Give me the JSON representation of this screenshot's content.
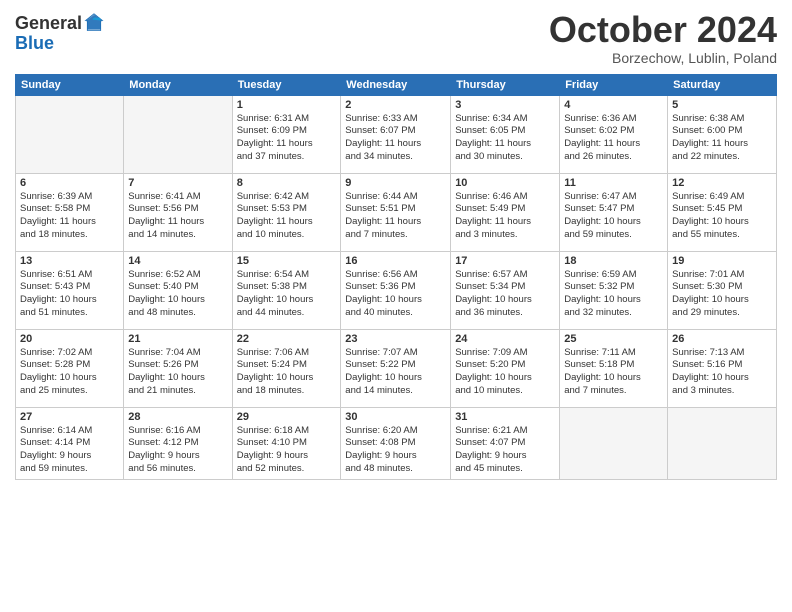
{
  "header": {
    "logo_general": "General",
    "logo_blue": "Blue",
    "month": "October 2024",
    "location": "Borzechow, Lublin, Poland"
  },
  "weekdays": [
    "Sunday",
    "Monday",
    "Tuesday",
    "Wednesday",
    "Thursday",
    "Friday",
    "Saturday"
  ],
  "weeks": [
    [
      {
        "day": "",
        "detail": ""
      },
      {
        "day": "",
        "detail": ""
      },
      {
        "day": "1",
        "detail": "Sunrise: 6:31 AM\nSunset: 6:09 PM\nDaylight: 11 hours\nand 37 minutes."
      },
      {
        "day": "2",
        "detail": "Sunrise: 6:33 AM\nSunset: 6:07 PM\nDaylight: 11 hours\nand 34 minutes."
      },
      {
        "day": "3",
        "detail": "Sunrise: 6:34 AM\nSunset: 6:05 PM\nDaylight: 11 hours\nand 30 minutes."
      },
      {
        "day": "4",
        "detail": "Sunrise: 6:36 AM\nSunset: 6:02 PM\nDaylight: 11 hours\nand 26 minutes."
      },
      {
        "day": "5",
        "detail": "Sunrise: 6:38 AM\nSunset: 6:00 PM\nDaylight: 11 hours\nand 22 minutes."
      }
    ],
    [
      {
        "day": "6",
        "detail": "Sunrise: 6:39 AM\nSunset: 5:58 PM\nDaylight: 11 hours\nand 18 minutes."
      },
      {
        "day": "7",
        "detail": "Sunrise: 6:41 AM\nSunset: 5:56 PM\nDaylight: 11 hours\nand 14 minutes."
      },
      {
        "day": "8",
        "detail": "Sunrise: 6:42 AM\nSunset: 5:53 PM\nDaylight: 11 hours\nand 10 minutes."
      },
      {
        "day": "9",
        "detail": "Sunrise: 6:44 AM\nSunset: 5:51 PM\nDaylight: 11 hours\nand 7 minutes."
      },
      {
        "day": "10",
        "detail": "Sunrise: 6:46 AM\nSunset: 5:49 PM\nDaylight: 11 hours\nand 3 minutes."
      },
      {
        "day": "11",
        "detail": "Sunrise: 6:47 AM\nSunset: 5:47 PM\nDaylight: 10 hours\nand 59 minutes."
      },
      {
        "day": "12",
        "detail": "Sunrise: 6:49 AM\nSunset: 5:45 PM\nDaylight: 10 hours\nand 55 minutes."
      }
    ],
    [
      {
        "day": "13",
        "detail": "Sunrise: 6:51 AM\nSunset: 5:43 PM\nDaylight: 10 hours\nand 51 minutes."
      },
      {
        "day": "14",
        "detail": "Sunrise: 6:52 AM\nSunset: 5:40 PM\nDaylight: 10 hours\nand 48 minutes."
      },
      {
        "day": "15",
        "detail": "Sunrise: 6:54 AM\nSunset: 5:38 PM\nDaylight: 10 hours\nand 44 minutes."
      },
      {
        "day": "16",
        "detail": "Sunrise: 6:56 AM\nSunset: 5:36 PM\nDaylight: 10 hours\nand 40 minutes."
      },
      {
        "day": "17",
        "detail": "Sunrise: 6:57 AM\nSunset: 5:34 PM\nDaylight: 10 hours\nand 36 minutes."
      },
      {
        "day": "18",
        "detail": "Sunrise: 6:59 AM\nSunset: 5:32 PM\nDaylight: 10 hours\nand 32 minutes."
      },
      {
        "day": "19",
        "detail": "Sunrise: 7:01 AM\nSunset: 5:30 PM\nDaylight: 10 hours\nand 29 minutes."
      }
    ],
    [
      {
        "day": "20",
        "detail": "Sunrise: 7:02 AM\nSunset: 5:28 PM\nDaylight: 10 hours\nand 25 minutes."
      },
      {
        "day": "21",
        "detail": "Sunrise: 7:04 AM\nSunset: 5:26 PM\nDaylight: 10 hours\nand 21 minutes."
      },
      {
        "day": "22",
        "detail": "Sunrise: 7:06 AM\nSunset: 5:24 PM\nDaylight: 10 hours\nand 18 minutes."
      },
      {
        "day": "23",
        "detail": "Sunrise: 7:07 AM\nSunset: 5:22 PM\nDaylight: 10 hours\nand 14 minutes."
      },
      {
        "day": "24",
        "detail": "Sunrise: 7:09 AM\nSunset: 5:20 PM\nDaylight: 10 hours\nand 10 minutes."
      },
      {
        "day": "25",
        "detail": "Sunrise: 7:11 AM\nSunset: 5:18 PM\nDaylight: 10 hours\nand 7 minutes."
      },
      {
        "day": "26",
        "detail": "Sunrise: 7:13 AM\nSunset: 5:16 PM\nDaylight: 10 hours\nand 3 minutes."
      }
    ],
    [
      {
        "day": "27",
        "detail": "Sunrise: 6:14 AM\nSunset: 4:14 PM\nDaylight: 9 hours\nand 59 minutes."
      },
      {
        "day": "28",
        "detail": "Sunrise: 6:16 AM\nSunset: 4:12 PM\nDaylight: 9 hours\nand 56 minutes."
      },
      {
        "day": "29",
        "detail": "Sunrise: 6:18 AM\nSunset: 4:10 PM\nDaylight: 9 hours\nand 52 minutes."
      },
      {
        "day": "30",
        "detail": "Sunrise: 6:20 AM\nSunset: 4:08 PM\nDaylight: 9 hours\nand 48 minutes."
      },
      {
        "day": "31",
        "detail": "Sunrise: 6:21 AM\nSunset: 4:07 PM\nDaylight: 9 hours\nand 45 minutes."
      },
      {
        "day": "",
        "detail": ""
      },
      {
        "day": "",
        "detail": ""
      }
    ]
  ]
}
